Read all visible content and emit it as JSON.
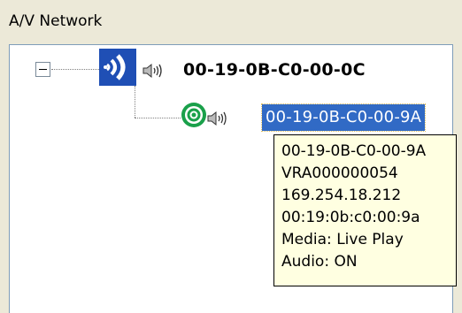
{
  "panel": {
    "title": "A/V Network"
  },
  "tree": {
    "parent": {
      "label": "00-19-0B-C0-00-0C",
      "icon": "wireless-transmitter-icon",
      "audio_icon": "speaker-icon"
    },
    "child": {
      "label": "00-19-0B-C0-00-9A",
      "icon": "receiver-target-icon",
      "audio_icon": "speaker-icon",
      "selected": true
    }
  },
  "tooltip": {
    "lines": [
      "00-19-0B-C0-00-9A",
      "VRA000000054",
      "169.254.18.212",
      "00:19:0b:c0:00:9a",
      "Media: Live Play",
      "Audio: ON"
    ]
  },
  "colors": {
    "selection": "#316ac5",
    "tooltip_bg": "#ffffe1",
    "transmitter_blue": "#1f4fb5",
    "receiver_green": "#1aa04a"
  }
}
